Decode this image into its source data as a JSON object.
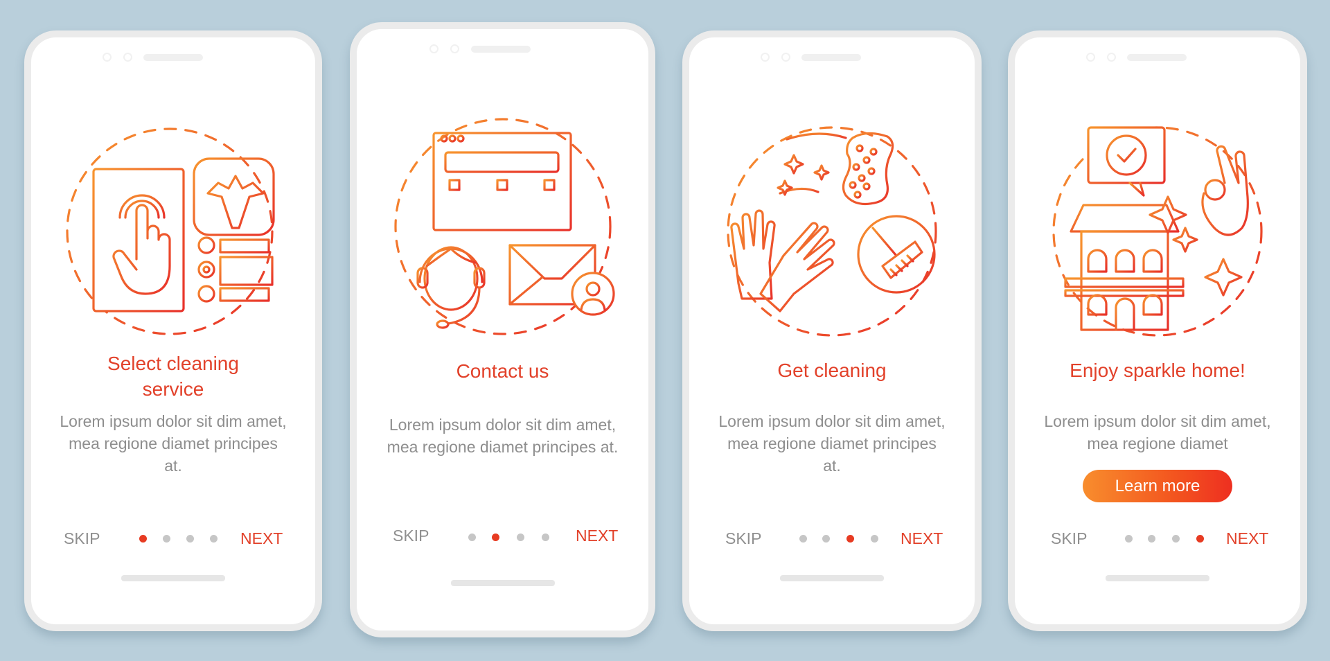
{
  "colors": {
    "background": "#b9cfdb",
    "accent": "#e2412a",
    "gradient_start": "#f88d2d",
    "gradient_end": "#ee2f20",
    "muted_text": "#8e8e8e",
    "dot_inactive": "#c6c6c6"
  },
  "screens": [
    {
      "illustration": "select-cleaning-service-illustration",
      "title": "Select cleaning service",
      "description": "Lorem ipsum dolor sit dim amet, mea regione diamet principes at.",
      "skip_label": "SKIP",
      "next_label": "NEXT",
      "page_index": 1,
      "page_count": 4
    },
    {
      "illustration": "contact-us-illustration",
      "title": "Contact us",
      "description": "Lorem ipsum dolor sit dim amet, mea regione diamet principes at.",
      "skip_label": "SKIP",
      "next_label": "NEXT",
      "page_index": 2,
      "page_count": 4
    },
    {
      "illustration": "get-cleaning-illustration",
      "title": "Get cleaning",
      "description": "Lorem ipsum dolor sit dim amet, mea regione diamet principes at.",
      "skip_label": "SKIP",
      "next_label": "NEXT",
      "page_index": 3,
      "page_count": 4
    },
    {
      "illustration": "sparkle-home-illustration",
      "title": "Enjoy sparkle home!",
      "description": "Lorem ipsum dolor sit dim amet, mea regione diamet",
      "button_label": "Learn more",
      "skip_label": "SKIP",
      "next_label": "NEXT",
      "page_index": 4,
      "page_count": 4
    }
  ]
}
